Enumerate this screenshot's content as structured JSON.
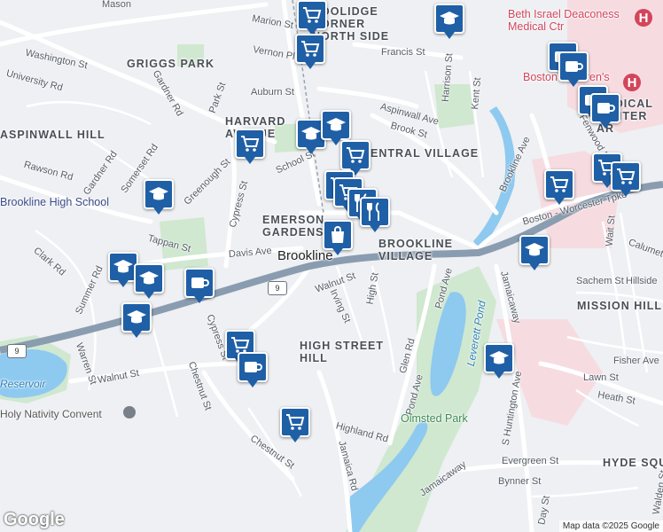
{
  "labels": {
    "griggs_park": "GRIGGS PARK",
    "aspinwall_hill": "ASPINWALL HILL",
    "harvard_avenue": "HARVARD AVENUE",
    "central_village": "CENTRAL VILLAGE",
    "emerson_gardens": "EMERSON GARDENS",
    "brookline_village": "BROOKLINE VILLAGE",
    "brookline": "Brookline",
    "high_street_hill": "HIGH STREET HILL",
    "mission_hill": "MISSION HILL",
    "medical_center": "MEDICAL CENTER AR",
    "hyde_sq": "HYDE SQU",
    "beth_israel": "Beth Israel Deaconess Medical Ctr",
    "boston_childrens": "Boston Children's",
    "brookline_hs": "Brookline High School",
    "holy_nativity": "Holy Nativity Convent",
    "olmsted_park": "Olmsted Park",
    "leverett_pond": "Leverett Pond",
    "reservoir": "Reservoir",
    "coolidge_corner": "COOLIDGE CORNER NORTH SIDE"
  },
  "streets": {
    "mason": "Mason",
    "washington": "Washington St",
    "university": "University Rd",
    "gardner": "Gardner Rd",
    "marion": "Marion St",
    "vernon": "Vernon Pl",
    "francis": "Francis St",
    "auburn": "Auburn St",
    "park": "Park St",
    "aspinwall": "Aspinwall Ave",
    "brook": "Brook St",
    "kent": "Kent St",
    "harrison": "Harrison St",
    "school": "School St",
    "rawson": "Rawson Rd",
    "gardner2": "Gardner Rd",
    "somerset": "Somerset Rd",
    "greenough": "Greenough St",
    "cypress": "Cypress St",
    "tappan": "Tappan St",
    "clark": "Clark Rd",
    "davis": "Davis Ave",
    "summer": "Summer Rd",
    "walnut": "Walnut St",
    "walnut2": "Walnut St",
    "irving": "Irving St",
    "high": "High St",
    "cypress2": "Cypress St",
    "chestnut": "Chestnut St",
    "chestnut2": "Chestnut St",
    "warren": "Warren St",
    "highland": "Highland Rd",
    "jamaica": "Jamaica Rd",
    "glen": "Glen Rd",
    "pond": "Pond Ave",
    "pond2": "Pond Ave",
    "jamaicaway": "Jamaicaway",
    "jamaicaway2": "Jamaicaway",
    "brookline_ave": "Brookline Ave",
    "fenwood": "Fenwood Rd",
    "boston_worcester": "Boston - Worcester Tpke",
    "wait": "Wait St",
    "calumet": "Calumet",
    "sachem": "Sachem St",
    "hillside": "Hillside",
    "s_huntington": "S Huntington Ave",
    "fisher": "Fisher Ave",
    "lawn": "Lawn St",
    "heath": "Heath St",
    "evergreen": "Evergreen St",
    "bynner": "Bynner St",
    "day": "Day St",
    "walden": "Walden St",
    "rt9a": "9",
    "rt9b": "9"
  },
  "icons": {
    "cart": "shopping-cart-icon",
    "cap": "graduation-cap-icon",
    "cup": "coffee-cup-icon",
    "fork": "restaurant-icon",
    "bag": "shopping-bag-icon"
  },
  "colors": {
    "pin": "#1f5fa6",
    "highway": "#8a9cb0",
    "park": "#cfe8cf",
    "water": "#8ec9f0",
    "hospital": "#f5d9de"
  },
  "footer": {
    "logo": "Google",
    "attribution": "Map data ©2025 Google"
  }
}
